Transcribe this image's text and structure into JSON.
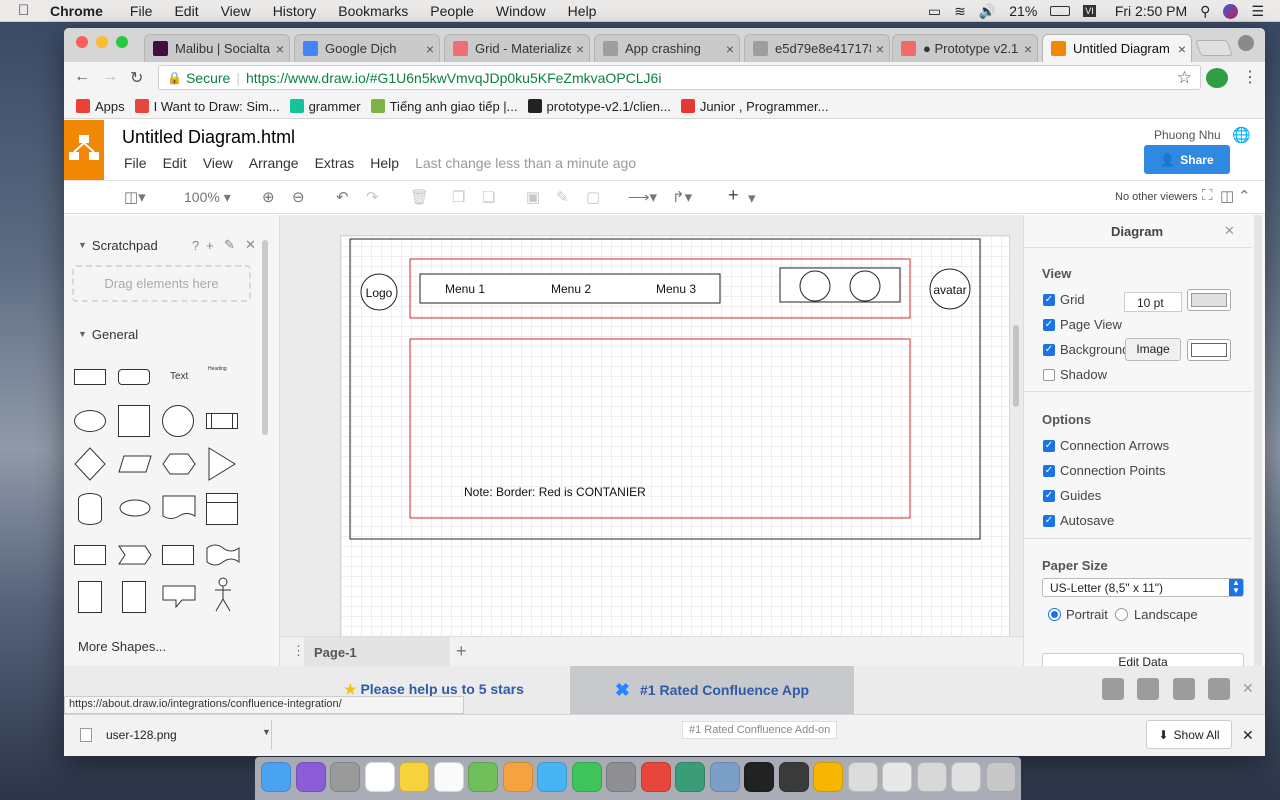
{
  "menubar": {
    "app": "Chrome",
    "items": [
      "File",
      "Edit",
      "View",
      "History",
      "Bookmarks",
      "People",
      "Window",
      "Help"
    ],
    "battery": "21%",
    "clock": "Fri 2:50 PM"
  },
  "tabs": [
    {
      "title": "Malibu | Socialtal",
      "icon": "slack-icon",
      "color": "#3f0f3f"
    },
    {
      "title": "Google Dịch",
      "icon": "google-translate-icon",
      "color": "#4285f4"
    },
    {
      "title": "Grid - Materialize",
      "icon": "materialize-icon",
      "color": "#ee6e73"
    },
    {
      "title": "App crashing",
      "icon": "document-icon",
      "color": "#9e9e9e"
    },
    {
      "title": "e5d79e8e417178",
      "icon": "document-icon",
      "color": "#9e9e9e"
    },
    {
      "title": "● Prototype v2.1",
      "icon": "asana-icon",
      "color": "#f06a6a"
    },
    {
      "title": "Untitled Diagram",
      "icon": "drawio-icon",
      "color": "#f08705",
      "active": true
    }
  ],
  "omnibox": {
    "secure_label": "Secure",
    "url": "https://www.draw.io/#G1U6n5kwVmvqJDp0ku5KFeZmkvaOPCLJ6i"
  },
  "bookmarks": [
    {
      "label": "Apps",
      "color": "#e94235"
    },
    {
      "label": "I Want to Draw: Sim...",
      "color": "#e8453c"
    },
    {
      "label": "grammer",
      "color": "#15c39a"
    },
    {
      "label": "Tiếng anh giao tiếp |...",
      "color": "#7cb342"
    },
    {
      "label": "prototype-v2.1/clien...",
      "color": "#222222"
    },
    {
      "label": "Junior , Programmer...",
      "color": "#e53935"
    }
  ],
  "drawio": {
    "title": "Untitled Diagram.html",
    "menu": [
      "File",
      "Edit",
      "View",
      "Arrange",
      "Extras",
      "Help"
    ],
    "last_change": "Last change less than a minute ago",
    "user": "Phuong Nhu",
    "share_label": "Share",
    "zoom": "100%",
    "viewers": "No other viewers"
  },
  "sidebar": {
    "scratchpad": "Scratchpad",
    "scratchpad_hint": "Drag elements here",
    "general": "General",
    "text_shape": "Text",
    "heading_shape": "Heading",
    "more_shapes": "More Shapes..."
  },
  "diagram": {
    "logo": "Logo",
    "menu1": "Menu 1",
    "menu2": "Menu 2",
    "menu3": "Menu 3",
    "avatar": "avatar",
    "note": "Note: Border: Red is CONTANIER",
    "border_color": "#d02b2b"
  },
  "panel": {
    "title": "Diagram",
    "view_heading": "View",
    "grid": "Grid",
    "grid_size": "10 pt",
    "page_view": "Page View",
    "background": "Background",
    "image_button": "Image",
    "shadow": "Shadow",
    "options_heading": "Options",
    "connection_arrows": "Connection Arrows",
    "connection_points": "Connection Points",
    "guides": "Guides",
    "autosave": "Autosave",
    "paper_heading": "Paper Size",
    "paper_size": "US-Letter (8,5\" x 11\")",
    "portrait": "Portrait",
    "landscape": "Landscape",
    "edit_data": "Edit Data"
  },
  "pages": {
    "current": "Page-1"
  },
  "banner": {
    "stars": "Please help us to 5 stars",
    "confluence": "#1 Rated Confluence App"
  },
  "status_url": "https://about.draw.io/integrations/confluence-integration/",
  "downloads": {
    "file": "user-128.png",
    "show_all": "Show All",
    "tooltip": "#1 Rated Confluence Add-on"
  }
}
